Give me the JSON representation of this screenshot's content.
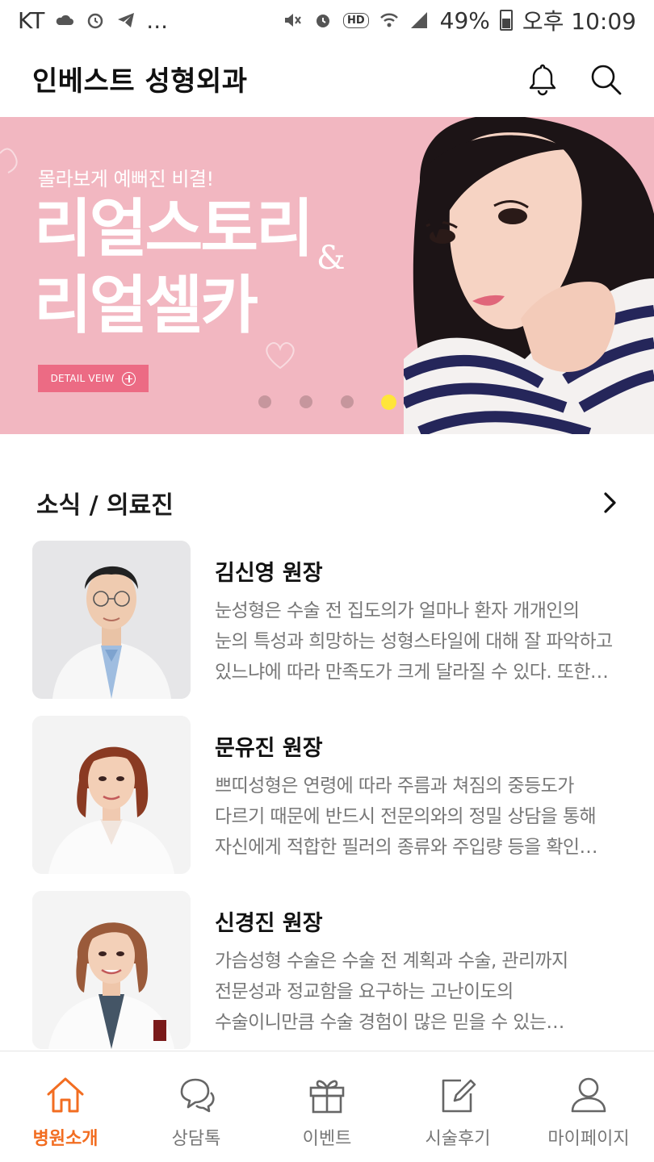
{
  "status_bar": {
    "carrier": "KT",
    "more": "...",
    "battery_percent": "49%",
    "time": "오후 10:09",
    "battery_level": 0.49,
    "hd_label": "HD"
  },
  "header": {
    "title": "인베스트 성형외과"
  },
  "banner": {
    "subtitle": "몰라보게 예뻐진 비결!",
    "title_line1": "리얼스토리",
    "amp": "&",
    "title_line2": "리얼셀카",
    "button_label": "DETAIL VEIW",
    "active_slide": 4,
    "slide_count": 4,
    "background_color": "#f2b7c1"
  },
  "section": {
    "title": "소식 / 의료진"
  },
  "doctors": [
    {
      "name": "김신영 원장",
      "lines": [
        "눈성형은 수술 전 집도의가 얼마나 환자 개개인의",
        "눈의 특성과 희망하는 성형스타일에 대해 잘 파악하고",
        "있느냐에 따라 만족도가 크게 달라질 수 있다. 또한…"
      ]
    },
    {
      "name": "문유진 원장",
      "lines": [
        "쁘띠성형은 연령에 따라 주름과 쳐짐의 중등도가",
        "다르기 때문에 반드시 전문의와의 정밀 상담을 통해",
        "자신에게 적합한 필러의 종류와 주입량 등을 확인…"
      ]
    },
    {
      "name": "신경진 원장",
      "lines": [
        "가슴성형 수술은 수술 전 계획과 수술, 관리까지",
        "전문성과 정교함을 요구하는 고난이도의",
        "수술이니만큼 수술 경험이 많은 믿을 수 있는…"
      ]
    }
  ],
  "bottom_nav": [
    {
      "label": "병원소개",
      "icon": "home-icon",
      "active": true
    },
    {
      "label": "상담톡",
      "icon": "chat-icon",
      "active": false
    },
    {
      "label": "이벤트",
      "icon": "gift-icon",
      "active": false
    },
    {
      "label": "시술후기",
      "icon": "edit-icon",
      "active": false
    },
    {
      "label": "마이페이지",
      "icon": "user-icon",
      "active": false
    }
  ],
  "colors": {
    "accent": "#f26d21",
    "banner_button": "#ec6b84",
    "active_dot": "#ffe53a"
  }
}
